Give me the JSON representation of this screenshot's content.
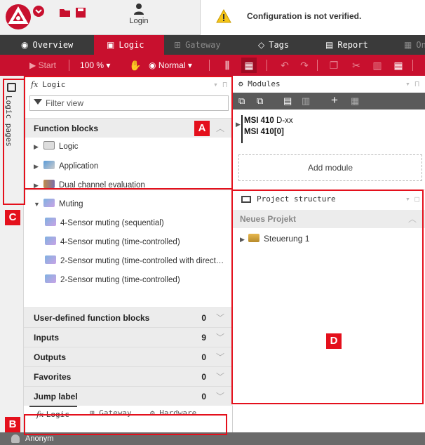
{
  "topbar": {
    "login_label": "Login",
    "notice_text": "Configuration is not verified.",
    "colors": {
      "brand": "#c8102e",
      "warning": "#f5c518"
    }
  },
  "tabs": [
    {
      "label": "Overview",
      "icon": "eye-icon"
    },
    {
      "label": "Logic",
      "icon": "logic-icon"
    },
    {
      "label": "Gateway",
      "icon": "gateway-icon"
    },
    {
      "label": "Tags",
      "icon": "tag-icon"
    },
    {
      "label": "Report",
      "icon": "document-icon"
    },
    {
      "label": "On",
      "icon": "online-icon"
    }
  ],
  "toolbar": {
    "start_label": "Start",
    "zoom_label": "100 %",
    "mode_label": "Normal"
  },
  "rail": {
    "label": "Logic pages"
  },
  "logic_panel": {
    "title": "Logic",
    "filter_placeholder": "Filter view",
    "function_blocks": {
      "title": "Function blocks",
      "items": [
        {
          "label": "Logic",
          "icon": "logic-gate-icon"
        },
        {
          "label": "Application",
          "icon": "application-icon"
        },
        {
          "label": "Dual channel evaluation",
          "icon": "dual-channel-icon"
        },
        {
          "label": "Muting",
          "icon": "muting-icon"
        }
      ],
      "muting_children": [
        "4-Sensor muting (sequential)",
        "4-Sensor muting (time-controlled)",
        "2-Sensor muting (time-controlled with direct…",
        "2-Sensor muting (time-controlled)"
      ]
    },
    "sections": [
      {
        "label": "User-defined function blocks",
        "count": "0"
      },
      {
        "label": "Inputs",
        "count": "9"
      },
      {
        "label": "Outputs",
        "count": "0"
      },
      {
        "label": "Favorites",
        "count": "0"
      },
      {
        "label": "Jump label",
        "count": "0"
      }
    ],
    "bottom_tabs": [
      "Logic",
      "Gateway",
      "Hardware"
    ]
  },
  "modules_panel": {
    "title": "Modules",
    "module_name": "MSI 410",
    "module_suffix": " D-xx",
    "module_instance": "MSI 410[0]",
    "add_module_label": "Add module"
  },
  "project_panel": {
    "title": "Project structure",
    "project_name": "Neues Projekt",
    "node_label": "Steuerung 1"
  },
  "status_bar": {
    "user": "Anonym"
  },
  "annotations": {
    "a": "A",
    "b": "B",
    "c": "C",
    "d": "D"
  }
}
